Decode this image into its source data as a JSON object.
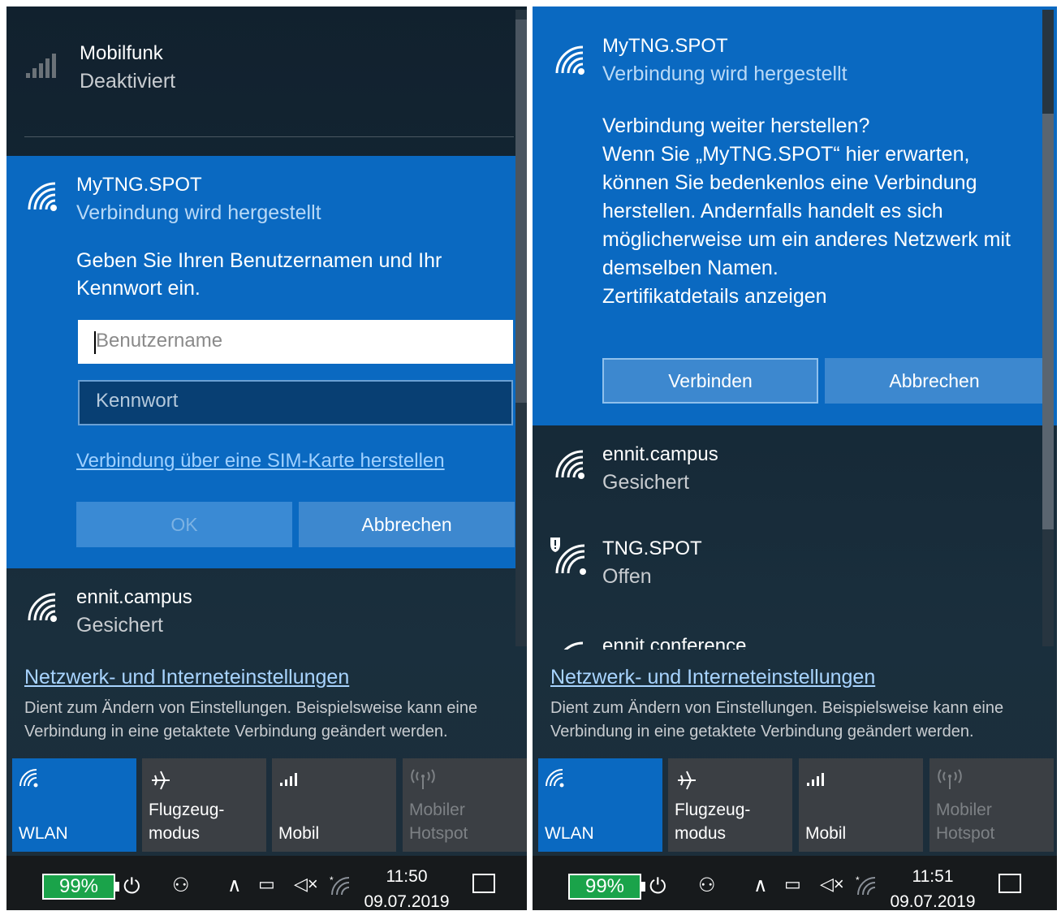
{
  "left": {
    "cellular": {
      "name": "Mobilfunk",
      "status": "Deaktiviert"
    },
    "connecting_network": {
      "name": "MyTNG.SPOT",
      "status": "Verbindung wird hergestellt",
      "prompt": "Geben Sie Ihren Benutzernamen und Ihr Kennwort ein.",
      "username_placeholder": "Benutzername",
      "password_placeholder": "Kennwort",
      "sim_link": "Verbindung über eine SIM-Karte herstellen",
      "ok_label": "OK",
      "cancel_label": "Abbrechen"
    },
    "networks": [
      {
        "name": "ennit.campus",
        "status": "Gesichert"
      }
    ],
    "settings": {
      "link": "Netzwerk- und Interneteinstellungen",
      "description": "Dient zum Ändern von Einstellungen. Beispielsweise kann eine Verbindung in eine getaktete Verbindung geändert werden."
    },
    "taskbar": {
      "battery": "99%",
      "time": "11:50",
      "date": "09.07.2019"
    }
  },
  "right": {
    "connecting_network": {
      "name": "MyTNG.SPOT",
      "status": "Verbindung wird hergestellt",
      "question": "Verbindung weiter herstellen?",
      "message": "Wenn Sie „MyTNG.SPOT“ hier erwarten, können Sie bedenkenlos eine Verbindung herstellen. Andernfalls handelt es sich möglicherweise um ein anderes Netzwerk mit demselben Namen.",
      "cert_link": "Zertifikatdetails anzeigen",
      "connect_label": "Verbinden",
      "cancel_label": "Abbrechen"
    },
    "networks": [
      {
        "name": "ennit.campus",
        "status": "Gesichert"
      },
      {
        "name": "TNG.SPOT",
        "status": "Offen"
      },
      {
        "name": "ennit.conference",
        "status": ""
      }
    ],
    "settings": {
      "link": "Netzwerk- und Interneteinstellungen",
      "description": "Dient zum Ändern von Einstellungen. Beispielsweise kann eine Verbindung in eine getaktete Verbindung geändert werden."
    },
    "taskbar": {
      "battery": "99%",
      "time": "11:51",
      "date": "09.07.2019"
    }
  },
  "quick_actions": [
    {
      "label": "WLAN",
      "icon": "wifi-icon",
      "active": true
    },
    {
      "label": "Flugzeug-\nmodus",
      "icon": "airplane-icon",
      "active": false
    },
    {
      "label": "Mobil",
      "icon": "cellular-icon",
      "active": false
    },
    {
      "label": "Mobiler\nHotspot",
      "icon": "hotspot-icon",
      "active": false
    }
  ],
  "colors": {
    "accent": "#0a69c1",
    "flyout_background": "#152836",
    "battery_green": "#1aa34a",
    "tile_inactive": "#3b3f44"
  }
}
